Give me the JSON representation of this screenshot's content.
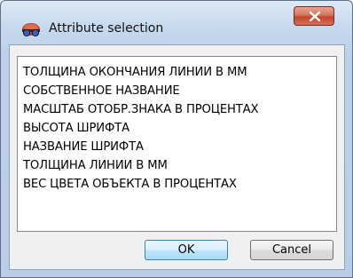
{
  "window": {
    "title": "Attribute selection",
    "icon": "3d-glasses-icon",
    "close_icon": "close-x-icon"
  },
  "attribute_list": {
    "items": [
      "ТОЛЩИНА ОКОНЧАНИЯ ЛИНИИ В ММ",
      "СОБСТВЕННОЕ НАЗВАНИЕ",
      "МАСШТАБ ОТОБР.ЗНАКА В ПРОЦЕНТАХ",
      "ВЫСОТА ШРИФТА",
      "НАЗВАНИЕ ШРИФТА",
      "ТОЛЩИНА ЛИНИИ В ММ",
      "ВЕС ЦВЕТА ОБЪЕКТА В ПРОЦЕНТАХ"
    ]
  },
  "buttons": {
    "ok_label": "OK",
    "cancel_label": "Cancel"
  },
  "colors": {
    "close_button": "#c4442a",
    "ok_button_border": "#3c7fb1"
  }
}
